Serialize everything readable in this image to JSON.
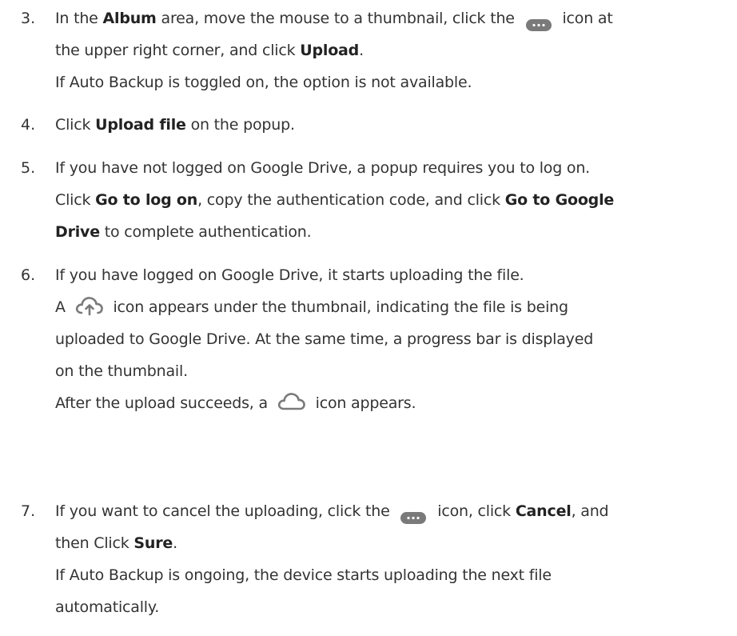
{
  "steps": [
    {
      "number": "3.",
      "lines": [
        {
          "t1": "In the ",
          "b1": "Album",
          "t2": " area, move the mouse to a thumbnail, click the ",
          "icon": "more-icon",
          "t3": " icon at"
        },
        {
          "t1": "the upper right corner, and click ",
          "b1": "Upload",
          "t2": "."
        },
        {
          "t1": "If Auto Backup is toggled on, the option is not available."
        }
      ]
    },
    {
      "number": "4.",
      "lines": [
        {
          "t1": "Click ",
          "b1": "Upload file",
          "t2": " on the popup."
        }
      ]
    },
    {
      "number": "5.",
      "lines": [
        {
          "t1": "If you have not logged on Google Drive, a popup requires you to log on."
        },
        {
          "t1": "Click ",
          "b1": "Go to log on",
          "t2": ", copy the authentication code, and click ",
          "b2": "Go to Google"
        },
        {
          "b1": "Drive",
          "t2": " to complete authentication."
        }
      ]
    },
    {
      "number": "6.",
      "lines": [
        {
          "t1": "If you have logged on Google Drive, it starts uploading the file."
        },
        {
          "t1": "A ",
          "icon": "cloud-upload-icon",
          "t2": " icon appears under the thumbnail, indicating the file is being"
        },
        {
          "t1": "uploaded to Google Drive. At the same time, a progress bar is displayed"
        },
        {
          "t1": "on the thumbnail."
        },
        {
          "t1": "After the upload succeeds, a ",
          "icon": "cloud-icon",
          "t2": " icon appears."
        }
      ]
    },
    {
      "number": "7.",
      "lines": [
        {
          "t1": "If you want to cancel the uploading, click the ",
          "icon": "more-icon",
          "t2": " icon, click ",
          "b1": "Cancel",
          "t3": ", and"
        },
        {
          "t1": "then Click ",
          "b1": "Sure",
          "t2": "."
        },
        {
          "t1": "If Auto Backup is ongoing, the device starts uploading the next file"
        },
        {
          "t1": "automatically."
        }
      ]
    }
  ]
}
